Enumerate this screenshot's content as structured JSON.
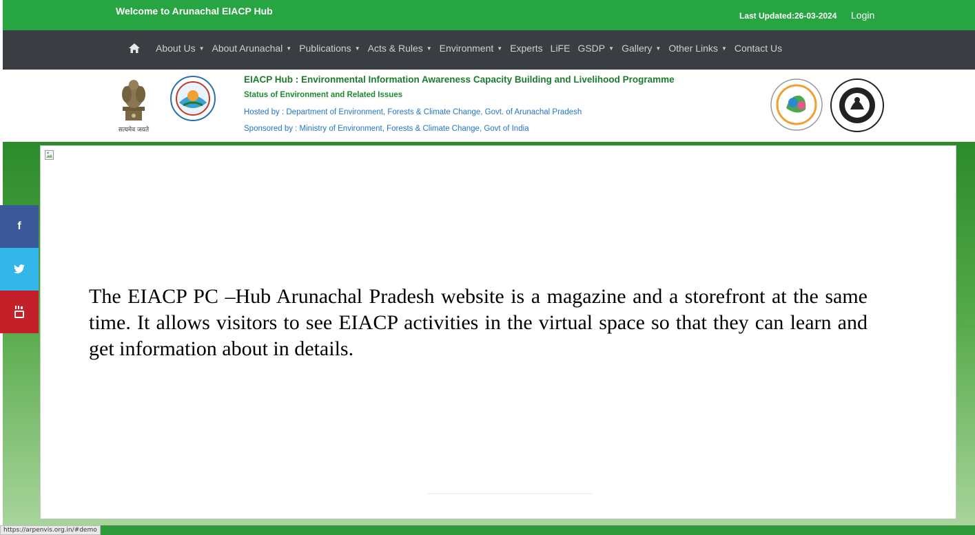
{
  "topbar": {
    "welcome": "Welcome to Arunachal EIACP Hub",
    "last_updated": "Last Updated:26-03-2024",
    "login": "Login"
  },
  "nav": {
    "items": [
      {
        "label": "About Us",
        "dropdown": true
      },
      {
        "label": "About Arunachal",
        "dropdown": true
      },
      {
        "label": "Publications",
        "dropdown": true
      },
      {
        "label": "Acts & Rules",
        "dropdown": true
      },
      {
        "label": "Environment",
        "dropdown": true
      },
      {
        "label": "Experts",
        "dropdown": false
      },
      {
        "label": "LiFE",
        "dropdown": false
      },
      {
        "label": "GSDP",
        "dropdown": true
      },
      {
        "label": "Gallery",
        "dropdown": true
      },
      {
        "label": "Other Links",
        "dropdown": true
      },
      {
        "label": "Contact Us",
        "dropdown": false
      }
    ],
    "caret": "▼"
  },
  "banner": {
    "title": "EIACP Hub : Environmental Information Awareness Capacity Building and Livelihood Programme",
    "subtitle": "Status of Environment and Related Issues",
    "hosted": "Hosted by : Department of Environment, Forests & Climate Change, Govt. of Arunachal Pradesh",
    "sponsored": "Sponsored by : Ministry of Environment, Forests & Climate Change, Govt of India",
    "emblem_caption": "सत्यमेव जयते"
  },
  "main": {
    "text": "The EIACP PC –Hub Arunachal Pradesh website is a magazine and a storefront at the same time. It allows visitors to see EIACP activities in the virtual space so that they can learn and get information about in details."
  },
  "social": {
    "facebook": "f",
    "facebook_icon": "facebook-icon",
    "twitter_icon": "twitter-icon",
    "youtube_icon": "youtube-icon"
  },
  "status_bar": {
    "url": "https://arpenvis.org.in/#demo"
  },
  "colors": {
    "topbar": "#27a543",
    "navbar": "#3a3e42",
    "title_green": "#1c7c2c",
    "link_blue": "#2476c8",
    "facebook": "#3b5998",
    "twitter": "#33b6ea",
    "youtube": "#c4202a"
  }
}
